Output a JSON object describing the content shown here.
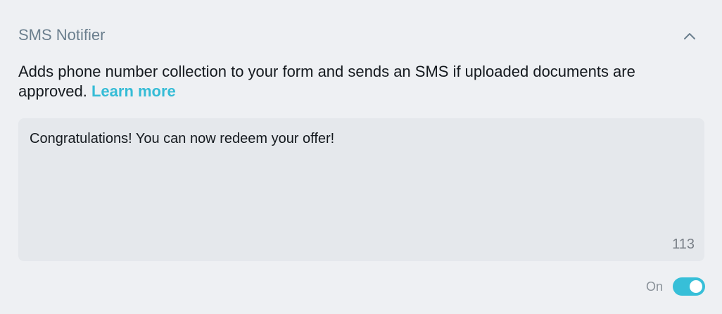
{
  "header": {
    "title": "SMS Notifier"
  },
  "description": {
    "text": "Adds phone number collection to your form and sends an SMS if uploaded documents are approved. ",
    "link_label": "Learn more"
  },
  "message": {
    "value": "Congratulations! You can now redeem your offer!",
    "char_count": "113"
  },
  "toggle": {
    "label": "On",
    "state": "on"
  },
  "colors": {
    "accent": "#35bcd6",
    "title": "#6b7f8e",
    "background": "#eef0f3",
    "field_background": "#e5e8ec"
  },
  "icons": {
    "collapse": "chevron-up-icon"
  }
}
